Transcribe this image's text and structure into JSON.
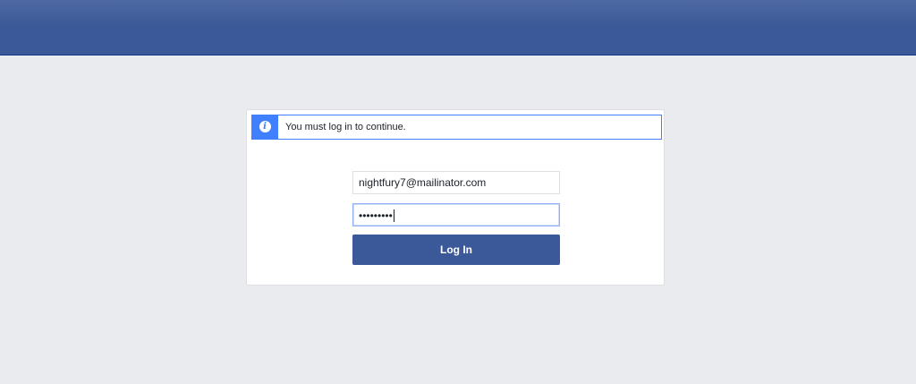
{
  "header": {
    "brand_color": "#3b5998"
  },
  "notice": {
    "icon": "info-icon",
    "icon_glyph": "i",
    "text": "You must log in to continue.",
    "accent": "#4080ff"
  },
  "login_form": {
    "email_value": "nightfury7@mailinator.com",
    "password_value": "•••••••••",
    "login_button_label": "Log In"
  }
}
